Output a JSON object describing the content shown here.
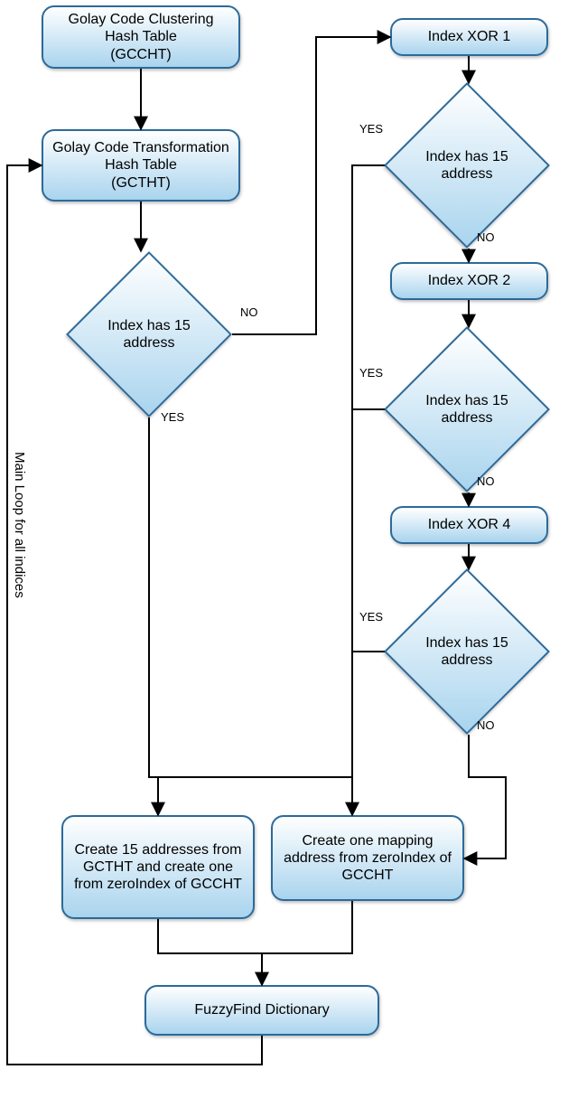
{
  "nodes": {
    "gccht": "Golay Code Clustering Hash Table\n(GCCHT)",
    "gctht": "Golay Code Transformation Hash Table\n(GCTHT)",
    "dec1": "Index has 15 address",
    "xor1": "Index XOR 1",
    "dec2": "Index has 15 address",
    "xor2": "Index XOR 2",
    "dec3": "Index has 15 address",
    "xor4": "Index XOR 4",
    "dec4": "Index has 15 address",
    "create15": "Create 15 addresses from GCTHT and create one from zeroIndex of GCCHT",
    "create1": "Create one mapping address from zeroIndex of GCCHT",
    "fuzzy": "FuzzyFind Dictionary"
  },
  "edges": {
    "yes": "YES",
    "no": "NO",
    "loop": "Main Loop for all indices"
  }
}
